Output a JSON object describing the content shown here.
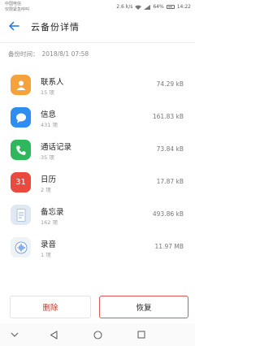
{
  "status_bar": {
    "carrier_line1": "中国电信",
    "carrier_line2": "仅限紧急呼叫",
    "speed": "2.6 k/s",
    "battery_percent": "64%",
    "time": "14:22"
  },
  "header": {
    "title": "云备份详情",
    "back_icon": "arrow-left-icon"
  },
  "backup_info": {
    "label": "备份时间：",
    "time": "2018/8/1 07:58"
  },
  "items": [
    {
      "name": "联系人",
      "count": "15 项",
      "size": "74.29 kB",
      "icon": "contacts-icon",
      "color": "#f6a23a"
    },
    {
      "name": "信息",
      "count": "431 项",
      "size": "161.83 kB",
      "icon": "messages-icon",
      "color": "#2f8cf0"
    },
    {
      "name": "通话记录",
      "count": "35 项",
      "size": "73.84 kB",
      "icon": "phone-icon",
      "color": "#2fb75b"
    },
    {
      "name": "日历",
      "count": "2 项",
      "size": "17.87 kB",
      "icon": "calendar-icon",
      "color": "#e9493f",
      "calendar_day": "31"
    },
    {
      "name": "备忘录",
      "count": "162 项",
      "size": "493.86 kB",
      "icon": "notepad-icon",
      "color": "#dfe8f3"
    },
    {
      "name": "录音",
      "count": "1 项",
      "size": "11.97 MB",
      "icon": "recorder-icon",
      "color": "#eef3f8"
    }
  ],
  "actions": {
    "delete_label": "删除",
    "restore_label": "恢复"
  },
  "nav": {
    "items": [
      "chevron-down-icon",
      "back-triangle-icon",
      "home-circle-icon",
      "recents-square-icon"
    ]
  }
}
